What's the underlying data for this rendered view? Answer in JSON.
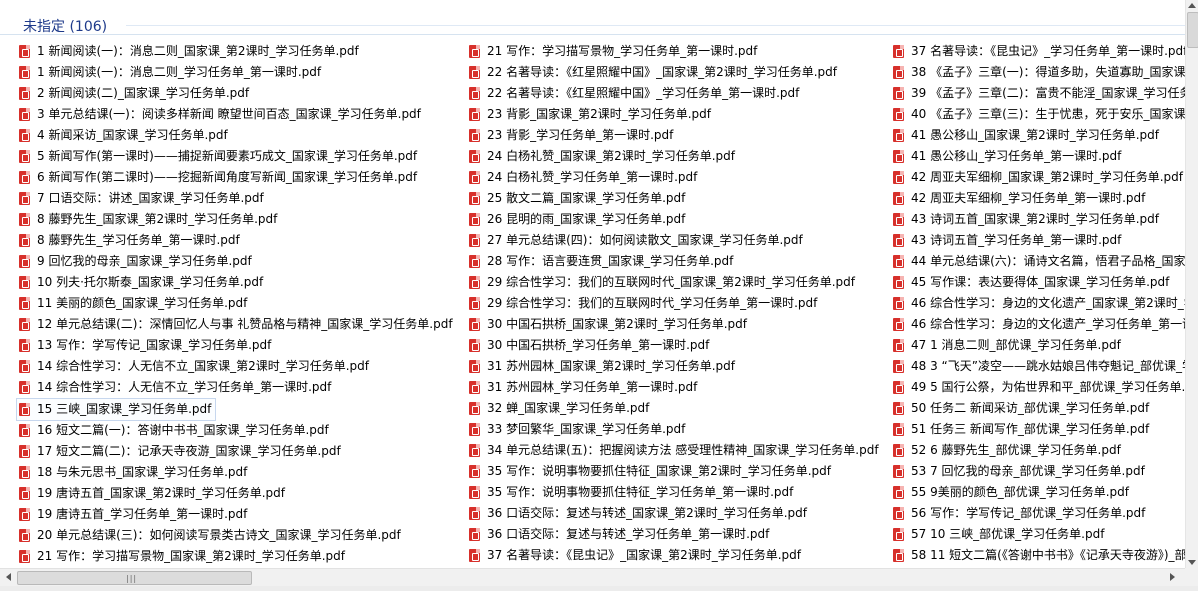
{
  "group": {
    "title": "未指定 (106)"
  },
  "columns": [
    [
      "1 新闻阅读(一)：消息二则_国家课_第2课时_学习任务单.pdf",
      "1 新闻阅读(一)：消息二则_学习任务单_第一课时.pdf",
      "2 新闻阅读(二)_国家课_学习任务单.pdf",
      "3 单元总结课(一)：阅读多样新闻 瞭望世间百态_国家课_学习任务单.pdf",
      "4 新闻采访_国家课_学习任务单.pdf",
      "5 新闻写作(第一课时)——捕捉新闻要素巧成文_国家课_学习任务单.pdf",
      "6 新闻写作(第二课时)——挖掘新闻角度写新闻_国家课_学习任务单.pdf",
      "7 口语交际：讲述_国家课_学习任务单.pdf",
      "8 藤野先生_国家课_第2课时_学习任务单.pdf",
      "8 藤野先生_学习任务单_第一课时.pdf",
      "9 回忆我的母亲_国家课_学习任务单.pdf",
      "10 列夫·托尔斯泰_国家课_学习任务单.pdf",
      "11 美丽的颜色_国家课_学习任务单.pdf",
      "12 单元总结课(二)：深情回忆人与事 礼赞品格与精神_国家课_学习任务单.pdf",
      "13 写作：学写传记_国家课_学习任务单.pdf",
      "14 综合性学习：人无信不立_国家课_第2课时_学习任务单.pdf",
      "14 综合性学习：人无信不立_学习任务单_第一课时.pdf",
      "15 三峡_国家课_学习任务单.pdf",
      "16 短文二篇(一)：答谢中书书_国家课_学习任务单.pdf",
      "17 短文二篇(二)：记承天寺夜游_国家课_学习任务单.pdf",
      "18 与朱元思书_国家课_学习任务单.pdf",
      "19 唐诗五首_国家课_第2课时_学习任务单.pdf",
      "19 唐诗五首_学习任务单_第一课时.pdf",
      "20 单元总结课(三)：如何阅读写景类古诗文_国家课_学习任务单.pdf",
      "21 写作：学习描写景物_国家课_第2课时_学习任务单.pdf"
    ],
    [
      "21 写作：学习描写景物_学习任务单_第一课时.pdf",
      "22 名著导读：《红星照耀中国》_国家课_第2课时_学习任务单.pdf",
      "22 名著导读：《红星照耀中国》_学习任务单_第一课时.pdf",
      "23 背影_国家课_第2课时_学习任务单.pdf",
      "23 背影_学习任务单_第一课时.pdf",
      "24 白杨礼赞_国家课_第2课时_学习任务单.pdf",
      "24 白杨礼赞_学习任务单_第一课时.pdf",
      "25 散文二篇_国家课_学习任务单.pdf",
      "26 昆明的雨_国家课_学习任务单.pdf",
      "27 单元总结课(四)：如何阅读散文_国家课_学习任务单.pdf",
      "28 写作：语言要连贯_国家课_学习任务单.pdf",
      "29 综合性学习：我们的互联网时代_国家课_第2课时_学习任务单.pdf",
      "29 综合性学习：我们的互联网时代_学习任务单_第一课时.pdf",
      "30 中国石拱桥_国家课_第2课时_学习任务单.pdf",
      "30 中国石拱桥_学习任务单_第一课时.pdf",
      "31 苏州园林_国家课_第2课时_学习任务单.pdf",
      "31 苏州园林_学习任务单_第一课时.pdf",
      "32 蝉_国家课_学习任务单.pdf",
      "33 梦回繁华_国家课_学习任务单.pdf",
      "34 单元总结课(五)：把握阅读方法 感受理性精神_国家课_学习任务单.pdf",
      "35 写作：说明事物要抓住特征_国家课_第2课时_学习任务单.pdf",
      "35 写作：说明事物要抓住特征_学习任务单_第一课时.pdf",
      "36 口语交际：复述与转述_国家课_第2课时_学习任务单.pdf",
      "36 口语交际：复述与转述_学习任务单_第一课时.pdf",
      "37 名著导读：《昆虫记》_国家课_第2课时_学习任务单.pdf"
    ],
    [
      "37 名著导读：《昆虫记》_学习任务单_第一课时.pdf",
      "38 《孟子》三章(一)：得道多助，失道寡助_国家课_学",
      "39 《孟子》三章(二)：富贵不能淫_国家课_学习任务单",
      "40 《孟子》三章(三)：生于忧患，死于安乐_国家课_学",
      "41 愚公移山_国家课_第2课时_学习任务单.pdf",
      "41 愚公移山_学习任务单_第一课时.pdf",
      "42 周亚夫军细柳_国家课_第2课时_学习任务单.pdf",
      "42 周亚夫军细柳_学习任务单_第一课时.pdf",
      "43 诗词五首_国家课_第2课时_学习任务单.pdf",
      "43 诗词五首_学习任务单_第一课时.pdf",
      "44 单元总结课(六)：诵诗文名篇，悟君子品格_国家课_",
      "45 写作课：表达要得体_国家课_学习任务单.pdf",
      "46 综合性学习：身边的文化遗产_国家课_第2课时_学习",
      "46 综合性学习：身边的文化遗产_学习任务单_第一课时",
      "47 1 消息二则_部优课_学习任务单.pdf",
      "48 3 “飞天”凌空——跳水姑娘吕伟夺魁记_部优课_学",
      "49 5 国行公祭，为佑世界和平_部优课_学习任务单.pdf",
      "50 任务二 新闻采访_部优课_学习任务单.pdf",
      "51 任务三 新闻写作_部优课_学习任务单.pdf",
      "52 6 藤野先生_部优课_学习任务单.pdf",
      "53 7 回忆我的母亲_部优课_学习任务单.pdf",
      "55 9美丽的颜色_部优课_学习任务单.pdf",
      "56 写作：学写传记_部优课_学习任务单.pdf",
      "57 10 三峡_部优课_学习任务单.pdf",
      "58 11 短文二篇(《答谢中书书》《记承天寺夜游》)_部"
    ]
  ],
  "selected": {
    "column": 0,
    "index": 17
  },
  "scrollbar": {
    "grip_glyph": "|||"
  }
}
